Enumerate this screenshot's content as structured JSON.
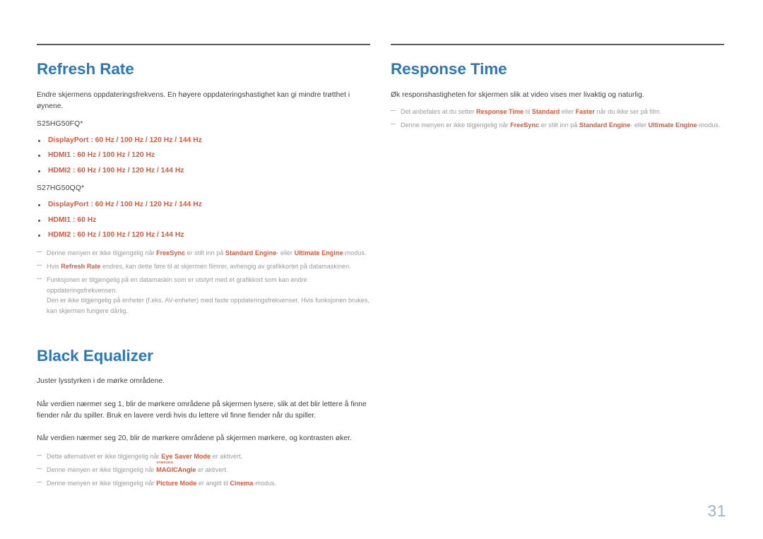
{
  "page": {
    "number": "31",
    "accent_blue": "#2a78ba",
    "accent_orange": "#e2573c",
    "note_gray": "#9a9a9c",
    "rule_color": "#59595c"
  },
  "left_column": {
    "refresh_rate": {
      "title": "Refresh Rate",
      "intro": "Endre skjermens oppdateringsfrekvens. En høyere oppdateringshastighet kan gi mindre trøtthet i øynene.",
      "model_1": "S25HG50FQ*",
      "model_1_options": [
        "DisplayPort : 60 Hz / 100 Hz / 120 Hz / 144 Hz",
        "HDMI1 : 60 Hz / 100 Hz / 120 Hz",
        "HDMI2 : 60 Hz / 100 Hz / 120 Hz / 144 Hz"
      ],
      "model_2": "S27HG50QQ*",
      "model_2_options": [
        "DisplayPort : 60 Hz / 100 Hz / 120 Hz / 144 Hz",
        "HDMI1 : 60 Hz",
        "HDMI2 : 60 Hz / 100 Hz / 120 Hz / 144 Hz"
      ],
      "note_1": {
        "part_1": "Denne menyen er ikke tilgjengelig når ",
        "hl_1": "FreeSync",
        "part_2": " er stilt inn på ",
        "hl_2": "Standard Engine",
        "part_3": "- eller ",
        "hl_3": "Ultimate Engine",
        "part_4": "-modus."
      },
      "note_2": {
        "part_1": "Hvis ",
        "hl_1": "Refresh Rate",
        "part_2": " endres, kan dette føre til at skjermen flimrer, avhengig av grafikkortet på datamaskinen."
      },
      "note_3": {
        "line_1": "Funksjonen er tilgjengelig på en datamaskin som er utstyrt med et grafikkort som kan endre oppdateringsfrekvensen.",
        "line_2": "Den er ikke tilgjengelig på enheter (f.eks. AV-enheter) med faste oppdateringsfrekvenser. Hvis funksjonen brukes, kan skjermen fungere dårlig."
      }
    },
    "black_equalizer": {
      "title": "Black Equalizer",
      "para_1": "Juster lysstyrken i de mørke områdene.",
      "para_2": "Når verdien nærmer seg 1, blir de mørkere områdene på skjermen lysere, slik at det blir lettere å finne fiender når du spiller. Bruk en lavere verdi hvis du lettere vil finne fiender når du spiller.",
      "para_3": "Når verdien nærmer seg 20, blir de mørkere områdene på skjermen mørkere, og kontrasten øker.",
      "note_1": {
        "part_1": "Dette alternativet er ikke tilgjengelig når ",
        "hl_1": "Eye Saver Mode",
        "part_2": " er aktivert."
      },
      "note_2": {
        "part_1": "Denne menyen er ikke tilgjengelig når ",
        "logo_top": "SAMSUNG",
        "logo_main": "MAGIC",
        "logo_suffix": "Angle",
        "part_2": " er aktivert."
      },
      "note_3": {
        "part_1": "Denne menyen er ikke tilgjengelig når ",
        "hl_1": "Picture Mode",
        "part_2": " er angitt til ",
        "hl_2": "Cinema",
        "part_3": "-modus."
      }
    }
  },
  "right_column": {
    "response_time": {
      "title": "Response Time",
      "intro": "Øk responshastigheten for skjermen slik at video vises mer livaktig og naturlig.",
      "note_1": {
        "part_1": "Det anbefales at du setter ",
        "hl_1": "Response Time",
        "part_2": " til ",
        "hl_2": "Standard",
        "part_3": " eller ",
        "hl_3": "Faster",
        "part_4": " når du ikke ser på film."
      },
      "note_2": {
        "part_1": "Denne menyen er ikke tilgjengelig når ",
        "hl_1": "FreeSync",
        "part_2": " er stilt inn på ",
        "hl_2": "Standard Engine",
        "part_3": "- eller ",
        "hl_3": "Ultimate Engine",
        "part_4": "-modus."
      }
    }
  }
}
